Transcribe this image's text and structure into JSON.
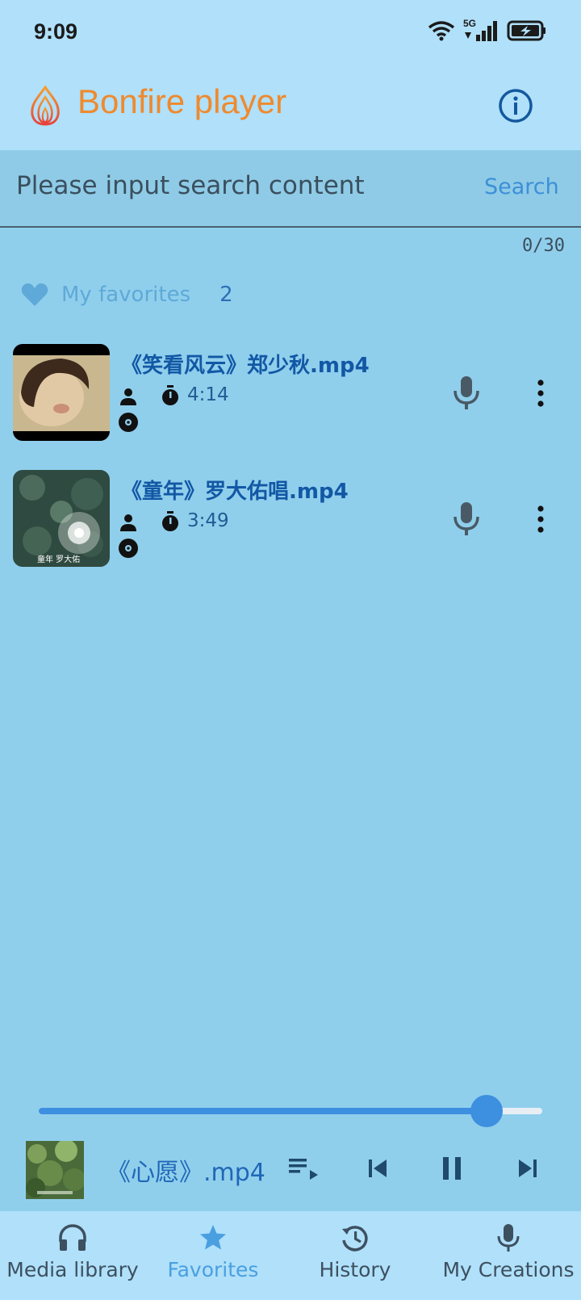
{
  "status_bar": {
    "time": "9:09",
    "network": "5G"
  },
  "app_bar": {
    "title": "Bonfire player"
  },
  "search": {
    "placeholder": "Please input search content",
    "button_label": "Search",
    "counter": "0/30"
  },
  "favorites_header": {
    "label": "My favorites",
    "count": "2"
  },
  "tracks": [
    {
      "title": "《笑看风云》郑少秋.mp4",
      "duration": "4:14"
    },
    {
      "title": "《童年》罗大佑唱.mp4",
      "duration": "3:49",
      "thumb_caption": "童年 罗大佑"
    }
  ],
  "player": {
    "now_playing": "《心愿》.mp4",
    "progress": 0.89
  },
  "bottom_nav": [
    {
      "label": "Media library",
      "icon": "headphones-icon"
    },
    {
      "label": "Favorites",
      "icon": "star-icon",
      "active": true
    },
    {
      "label": "History",
      "icon": "history-icon"
    },
    {
      "label": "My Creations",
      "icon": "mic-icon"
    }
  ],
  "colors": {
    "background": "#90cfec",
    "title_orange": "#ee8a2e",
    "accent_blue": "#3d8fe0",
    "track_title": "#1258a5"
  }
}
